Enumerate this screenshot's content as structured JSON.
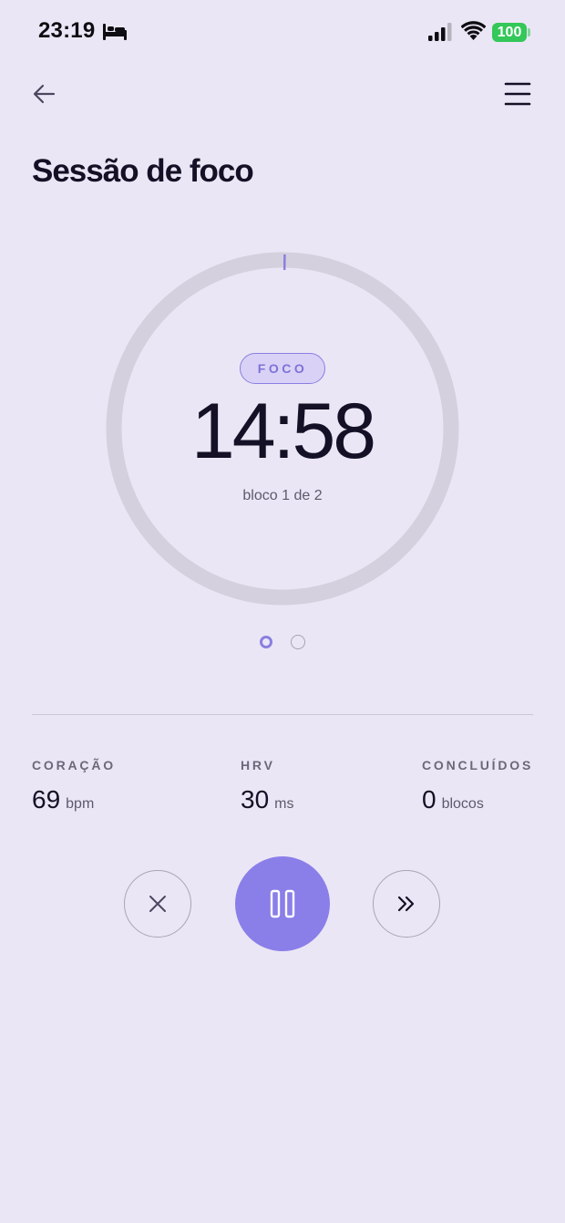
{
  "status_bar": {
    "time": "23:19",
    "battery": "100",
    "icons": [
      "bed-icon",
      "signal-icon",
      "wifi-icon",
      "battery-icon"
    ]
  },
  "nav": {
    "back_icon": "arrow-left-icon",
    "menu_icon": "hamburger-menu-icon"
  },
  "title": "Sessão de foco",
  "timer": {
    "mode": "FOCO",
    "value": "14:58",
    "block_label": "bloco 1 de 2",
    "progress_fraction": 0.002
  },
  "pagination": {
    "total": 2,
    "active": 1
  },
  "stats": [
    {
      "label": "CORAÇÃO",
      "value": "69",
      "unit": "bpm"
    },
    {
      "label": "HRV",
      "value": "30",
      "unit": "ms"
    },
    {
      "label": "CONCLUÍDOS",
      "value": "0",
      "unit": "blocos"
    }
  ],
  "controls": {
    "stop_icon": "close-icon",
    "pause_icon": "pause-icon",
    "skip_icon": "skip-forward-icon"
  },
  "colors": {
    "background": "#ebe6f5",
    "accent": "#8a7fe8",
    "ring_track": "#d5d0dd",
    "battery": "#34c759"
  }
}
